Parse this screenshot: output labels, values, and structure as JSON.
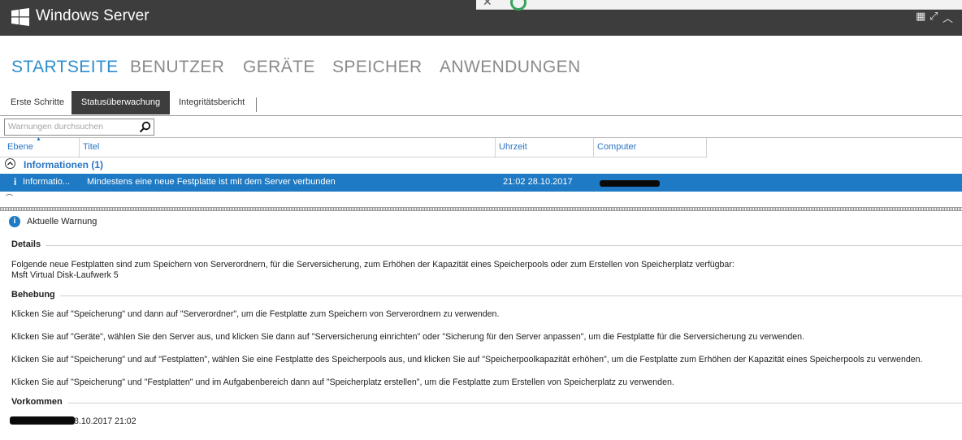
{
  "window": {
    "title": "Windows Server"
  },
  "nav": {
    "items": [
      {
        "label": "STARTSEITE"
      },
      {
        "label": "BENUTZER"
      },
      {
        "label": "GERÄTE"
      },
      {
        "label": "SPEICHER"
      },
      {
        "label": "ANWENDUNGEN"
      }
    ],
    "active_index": 0
  },
  "subtabs": {
    "items": [
      {
        "label": "Erste Schritte"
      },
      {
        "label": "Statusüberwachung"
      },
      {
        "label": "Integritätsbericht"
      }
    ],
    "active_index": 1
  },
  "search": {
    "placeholder": "Warnungen durchsuchen"
  },
  "table": {
    "columns": [
      "Ebene",
      "Titel",
      "Uhrzeit",
      "Computer"
    ],
    "group": {
      "label": "Informationen  (1)"
    },
    "rows": [
      {
        "level": "Informatio...",
        "title": "Mindestens eine neue Festplatte ist mit dem Server verbunden",
        "time": "21:02 28.10.2017",
        "computer": ""
      }
    ]
  },
  "detail": {
    "header": "Aktuelle Warnung",
    "details_heading": "Details",
    "details_lines": [
      "Folgende neue Festplatten sind zum Speichern von Serverordnern, für die Serversicherung, zum Erhöhen der Kapazität eines Speicherpools oder zum Erstellen von Speicherplatz verfügbar:",
      "Msft Virtual Disk-Laufwerk 5"
    ],
    "resolution_heading": "Behebung",
    "resolution_lines": [
      "Klicken Sie auf \"Speicherung\" und dann auf \"Serverordner\", um die Festplatte zum Speichern von Serverordnern zu verwenden.",
      "Klicken Sie auf \"Geräte\", wählen Sie den Server aus, und klicken Sie dann auf \"Serversicherung einrichten\" oder \"Sicherung für den Server anpassen\", um die Festplatte für die Serversicherung zu verwenden.",
      "Klicken Sie auf \"Speicherung\" und auf \"Festplatten\", wählen Sie eine Festplatte des Speicherpools aus, und klicken Sie auf \"Speicherpoolkapazität erhöhen\", um die Festplatte zum Erhöhen der Kapazität eines Speicherpools zu verwenden.",
      "Klicken Sie auf \"Speicherung\" und \"Festplatten\" und im Aufgabenbereich dann auf \"Speicherplatz erstellen\", um die Festplatte zum Erstellen von Speicherplatz zu verwenden."
    ],
    "occurrence_heading": "Vorkommen",
    "occurrence_value": "8.10.2017 21:02"
  },
  "colors": {
    "titlebar": "#3d3d3d",
    "accent": "#2d8ed1",
    "selection": "#1e7ac4",
    "link_header": "#2a75c4"
  },
  "icons": [
    "windows-logo-icon",
    "search-icon",
    "collapse-icon",
    "info-icon"
  ]
}
